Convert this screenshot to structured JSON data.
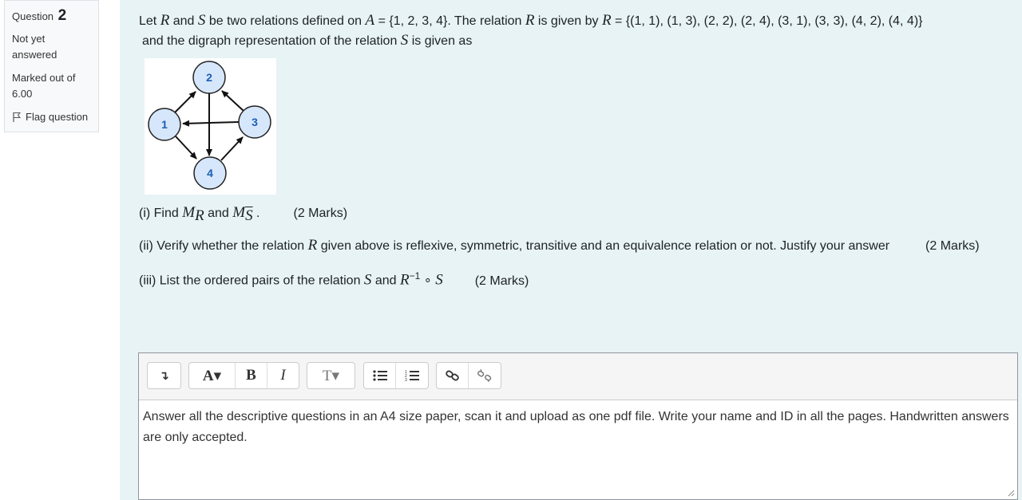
{
  "qinfo": {
    "question_word": "Question",
    "question_number": "2",
    "state": "Not yet answered",
    "grade": "Marked out of 6.00",
    "flag_label": "Flag question"
  },
  "question": {
    "intro_1": "Let ",
    "R": "R",
    "and": " and ",
    "S": "S",
    "intro_2": " be two relations defined on ",
    "A": "A",
    "setA": " = {1, 2, 3, 4}. The relation ",
    "given_by": " is given by ",
    "setR": " = {(1, 1), (1, 3), (2, 2), (2, 4), (3, 1), (3, 3), (4, 2), (4, 4)}",
    "line2_a": "and the digraph representation of the relation ",
    "line2_b": " is given as"
  },
  "digraph": {
    "nodes": [
      "1",
      "2",
      "3",
      "4"
    ]
  },
  "parts": {
    "p1_prefix": "(i) Find ",
    "p1_M": "M",
    "p1_R": "R",
    "p1_and": " and ",
    "p1_S": "S",
    "p1_dot": " .",
    "p1_marks": "(2 Marks)",
    "p2_a": "(ii) Verify whether the relation ",
    "p2_R": "R",
    "p2_b": " given above is reflexive, symmetric, transitive and an equivalence relation or not. Justify your answer",
    "p2_marks": "(2 Marks)",
    "p3_a": "(iii)  List the ordered pairs of the relation ",
    "p3_S": "S",
    "p3_and": " and ",
    "p3_R": "R",
    "p3_sup": "−1",
    "p3_op": " ∘ ",
    "p3_S2": "S",
    "p3_marks": "(2 Marks)"
  },
  "editor": {
    "toolbar": {
      "expand": "↴",
      "font": "A▾",
      "bold": "B",
      "italic": "I",
      "style": "T▾"
    },
    "text": "Answer all the descriptive questions in an A4 size paper, scan it and upload as one pdf file. Write your name and ID in all the pages. Handwritten answers are only accepted."
  },
  "colors": {
    "content_bg": "#e7f3f5",
    "node_fill": "#d6e6fb",
    "node_text": "#1a5fb4"
  }
}
